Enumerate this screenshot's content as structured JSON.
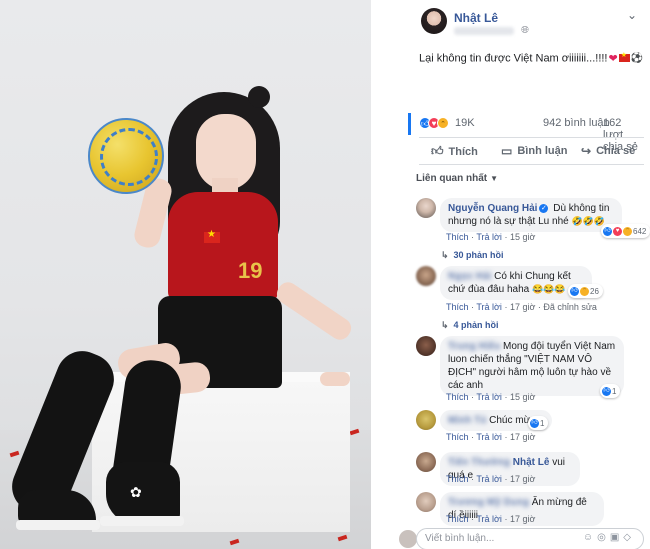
{
  "post": {
    "author": "Nhật Lê",
    "text": "Lại không tin được Việt Nam ơiiiiiii...!!!!",
    "reaction_count": "19K",
    "comment_count": "942 bình luận",
    "share_count": "162 lượt chia sẻ"
  },
  "actions": {
    "like": "Thích",
    "comment": "Bình luận",
    "share": "Chia sẻ"
  },
  "filter_label": "Liên quan nhất",
  "comments": [
    {
      "name": "Nguyễn Quang Hải",
      "text": "Dù không tin nhưng nó là sự thật Lu nhé",
      "like": "Thích",
      "reply": "Trả lời",
      "time": "15 giờ",
      "reactions": "642",
      "replies": "30 phản hồi"
    },
    {
      "name": "",
      "text": "Có khi Chung kết chứ đùa đâu haha",
      "like": "Thích",
      "reply": "Trả lời",
      "time": "17 giờ",
      "edited": "Đã chỉnh sửa",
      "reactions": "26",
      "replies": "4 phản hồi"
    },
    {
      "name": "",
      "text": "Mong đội tuyển Việt Nam luon chiến thắng \"VIỆT NAM VÔ ĐỊCH\" người hâm mộ luôn tự hào về các anh",
      "like": "Thích",
      "reply": "Trả lời",
      "time": "15 giờ",
      "reactions": "1"
    },
    {
      "name": "",
      "text": "Chúc mừng",
      "like": "Thích",
      "reply": "Trả lời",
      "time": "17 giờ",
      "reactions": "1"
    },
    {
      "name": "Nhật Lê",
      "text": "vui quá e",
      "like": "Thích",
      "reply": "Trả lời",
      "time": "17 giờ"
    },
    {
      "name": "",
      "text": "Ăn mừng đê dí ềiiiiii",
      "like": "Thích",
      "reply": "Trả lời",
      "time": "17 giờ"
    }
  ],
  "write_placeholder": "Viết bình luận..."
}
